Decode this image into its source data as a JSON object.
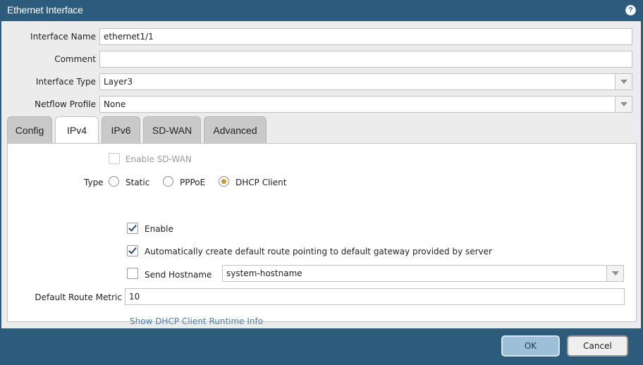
{
  "window": {
    "title": "Ethernet Interface"
  },
  "form": {
    "interface_name": {
      "label": "Interface Name",
      "value": "ethernet1/1"
    },
    "comment": {
      "label": "Comment",
      "value": ""
    },
    "interface_type": {
      "label": "Interface Type",
      "value": "Layer3"
    },
    "netflow_profile": {
      "label": "Netflow Profile",
      "value": "None"
    }
  },
  "tabs": [
    {
      "label": "Config",
      "active": false
    },
    {
      "label": "IPv4",
      "active": true
    },
    {
      "label": "IPv6",
      "active": false
    },
    {
      "label": "SD-WAN",
      "active": false
    },
    {
      "label": "Advanced",
      "active": false
    }
  ],
  "ipv4": {
    "enable_sdwan": {
      "label": "Enable SD-WAN",
      "checked": false,
      "disabled": true
    },
    "type": {
      "label": "Type",
      "options": [
        "Static",
        "PPPoE",
        "DHCP Client"
      ],
      "selected": "DHCP Client"
    },
    "enable": {
      "label": "Enable",
      "checked": true
    },
    "auto_default_route": {
      "label": "Automatically create default route pointing to default gateway provided by server",
      "checked": true
    },
    "send_hostname": {
      "label": "Send Hostname",
      "checked": false,
      "value": "system-hostname"
    },
    "default_route_metric": {
      "label": "Default Route Metric",
      "value": "10"
    },
    "runtime_link": "Show DHCP Client Runtime Info"
  },
  "buttons": {
    "ok": "OK",
    "cancel": "Cancel"
  },
  "colors": {
    "titlebar": "#2d5b7c",
    "radio_selected": "#c99a2c",
    "link": "#4f84ac"
  }
}
